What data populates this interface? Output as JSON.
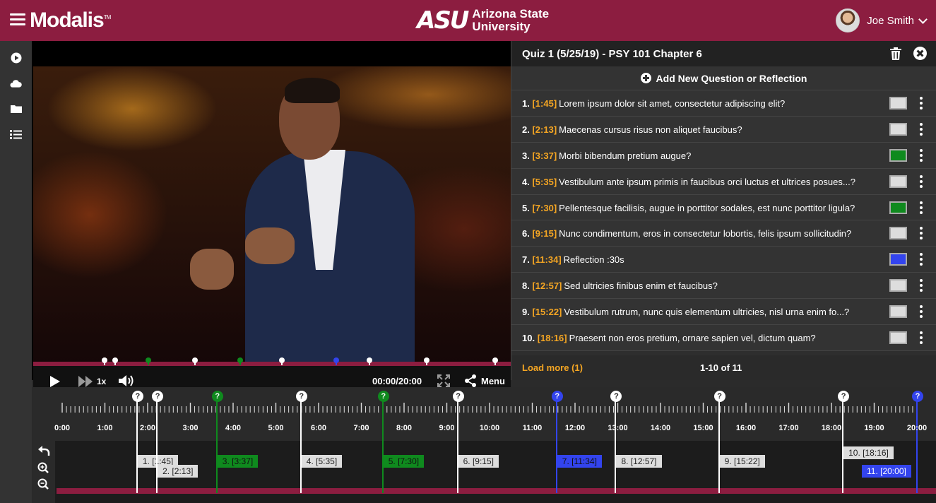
{
  "header": {
    "app_name": "Modalis",
    "trademark": "TM",
    "org_mark": "ASU",
    "org_line1": "Arizona State",
    "org_line2": "University",
    "user_name": "Joe Smith"
  },
  "sidebar": {
    "items": [
      "play-icon",
      "cloud-icon",
      "folder-icon",
      "list-icon"
    ]
  },
  "player": {
    "speed": "1x",
    "time": "00:00/20:00",
    "menu": "Menu",
    "duration_s": 1200
  },
  "quiz": {
    "title": "Quiz 1 (5/25/19) - PSY 101 Chapter 6",
    "add_label": "Add New Question or Reflection",
    "items": [
      {
        "num": "1.",
        "time": "[1:45]",
        "text": "Lorem ipsum dolor sit amet, consectetur adipiscing elit?",
        "color": "#dddddd",
        "seconds": 105
      },
      {
        "num": "2.",
        "time": "[2:13]",
        "text": "Maecenas cursus risus non aliquet faucibus?",
        "color": "#dddddd",
        "seconds": 133
      },
      {
        "num": "3.",
        "time": "[3:37]",
        "text": "Morbi bibendum pretium augue?",
        "color": "#0f8a1e",
        "seconds": 217
      },
      {
        "num": "4.",
        "time": "[5:35]",
        "text": "Vestibulum ante ipsum primis in faucibus orci luctus et ultrices posues...?",
        "color": "#dddddd",
        "seconds": 335
      },
      {
        "num": "5.",
        "time": "[7:30]",
        "text": "Pellentesque facilisis, augue in porttitor sodales, est nunc porttitor ligula?",
        "color": "#0f8a1e",
        "seconds": 450
      },
      {
        "num": "6.",
        "time": "[9:15]",
        "text": "Nunc condimentum, eros in consectetur lobortis, felis ipsum sollicitudin?",
        "color": "#dddddd",
        "seconds": 555
      },
      {
        "num": "7.",
        "time": "[11:34]",
        "text": "Reflection :30s",
        "color": "#3344ee",
        "seconds": 694
      },
      {
        "num": "8.",
        "time": "[12:57]",
        "text": "Sed ultricies finibus enim et faucibus?",
        "color": "#dddddd",
        "seconds": 777
      },
      {
        "num": "9.",
        "time": "[15:22]",
        "text": "Vestibulum rutrum, nunc quis elementum ultricies, nisl urna enim fo...?",
        "color": "#dddddd",
        "seconds": 922
      },
      {
        "num": "10.",
        "time": "[18:16]",
        "text": "Praesent non eros pretium, ornare sapien vel, dictum quam?",
        "color": "#dddddd",
        "seconds": 1096
      }
    ],
    "load_more": "Load more (1)",
    "page_count": "1-10 of 11"
  },
  "timeline": {
    "labels": [
      "0:00",
      "1:00",
      "2:00",
      "3:00",
      "4:00",
      "5:00",
      "6:00",
      "7:00",
      "8:00",
      "9:00",
      "10:00",
      "11:00",
      "12:00",
      "13:00",
      "14:00",
      "15:00",
      "16:00",
      "17:00",
      "18:00",
      "19:00",
      "20:00"
    ],
    "pin_symbol": "?",
    "markers": [
      {
        "label": "1. [1:45]",
        "seconds": 105,
        "color": "#dddddd",
        "text_color": "#222222",
        "row": 0
      },
      {
        "label": "2. [2:13]",
        "seconds": 133,
        "color": "#dddddd",
        "text_color": "#222222",
        "row": 1
      },
      {
        "label": "3. [3:37]",
        "seconds": 217,
        "color": "#0f8a1e",
        "text_color": "#111111",
        "row": 0
      },
      {
        "label": "4. [5:35]",
        "seconds": 335,
        "color": "#dddddd",
        "text_color": "#222222",
        "row": 0
      },
      {
        "label": "5. [7:30]",
        "seconds": 450,
        "color": "#0f8a1e",
        "text_color": "#111111",
        "row": 0
      },
      {
        "label": "6. [9:15]",
        "seconds": 555,
        "color": "#dddddd",
        "text_color": "#222222",
        "row": 0
      },
      {
        "label": "7. [11:34]",
        "seconds": 694,
        "color": "#3344ee",
        "text_color": "#111111",
        "row": 0
      },
      {
        "label": "8. [12:57]",
        "seconds": 777,
        "color": "#dddddd",
        "text_color": "#222222",
        "row": 0
      },
      {
        "label": "9. [15:22]",
        "seconds": 922,
        "color": "#dddddd",
        "text_color": "#222222",
        "row": 0
      },
      {
        "label": "10. [18:16]",
        "seconds": 1096,
        "color": "#dddddd",
        "text_color": "#222222",
        "row": -1
      },
      {
        "label": "11. [20:00]",
        "seconds": 1200,
        "color": "#3344ee",
        "text_color": "#ffffff",
        "row": 1
      }
    ]
  },
  "colors": {
    "brand": "#8c1d40",
    "accent": "#f5a623"
  }
}
